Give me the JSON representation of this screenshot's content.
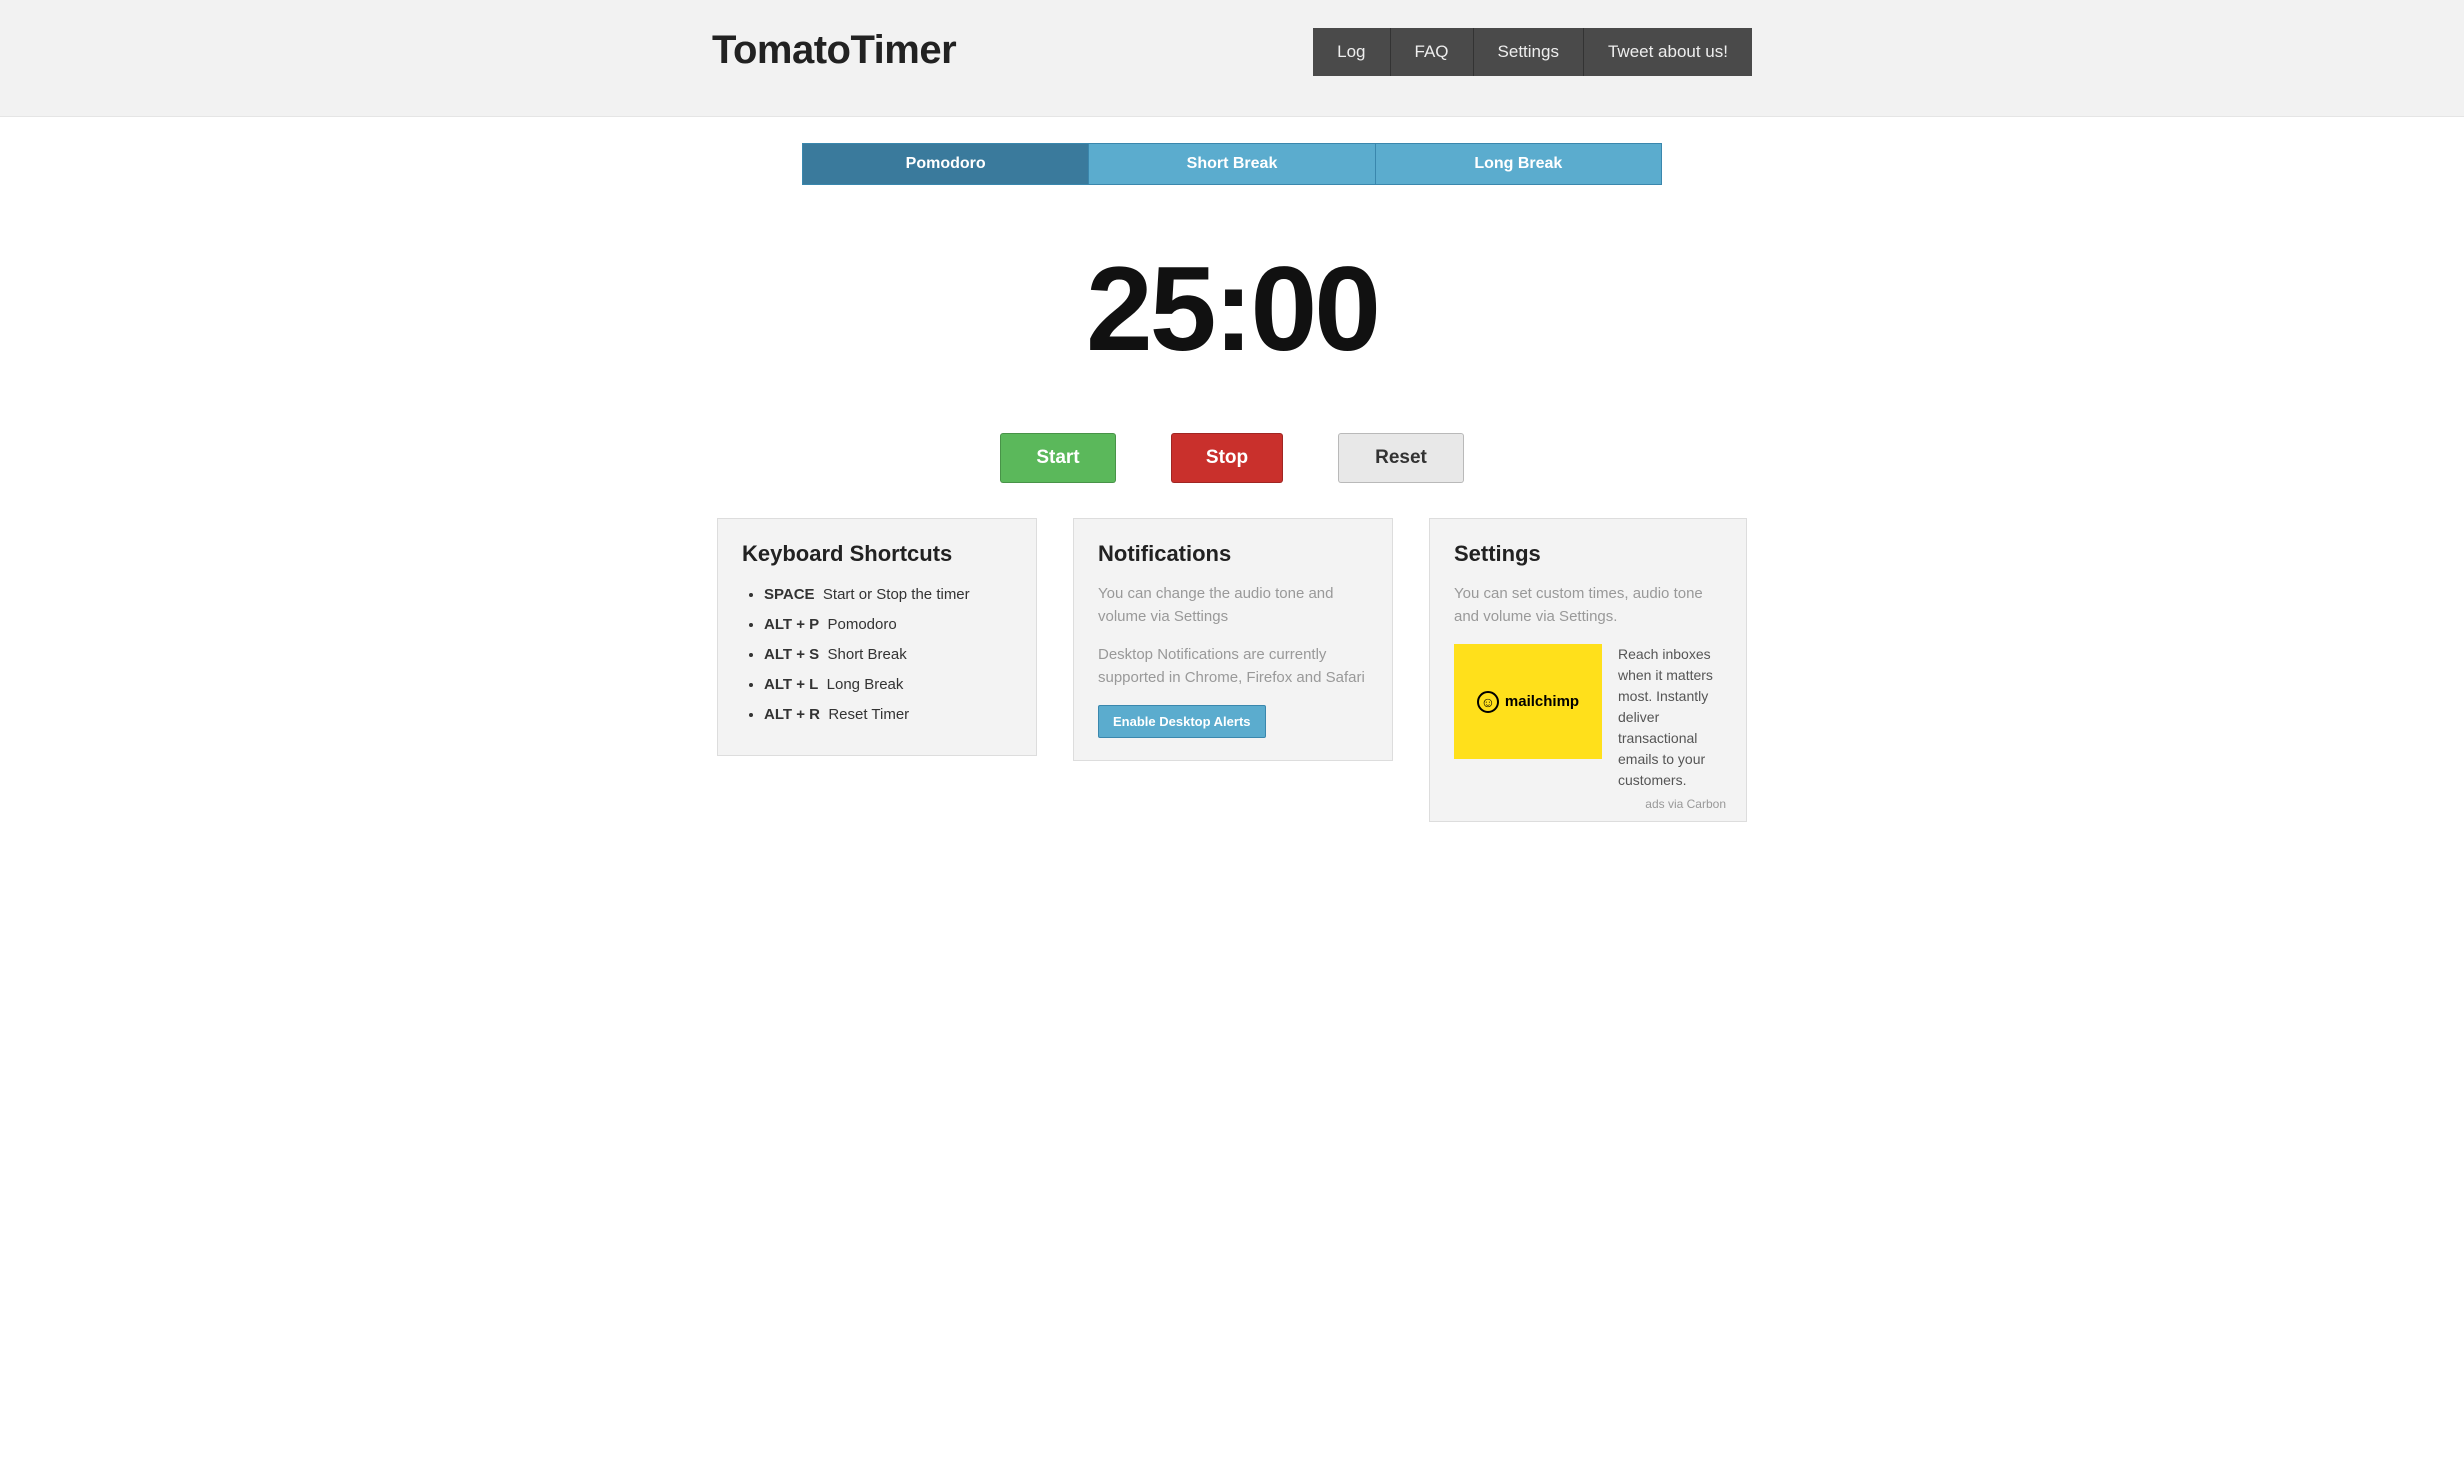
{
  "header": {
    "logo": "TomatoTimer",
    "nav": [
      "Log",
      "FAQ",
      "Settings",
      "Tweet about us!"
    ]
  },
  "tabs": [
    {
      "label": "Pomodoro",
      "active": true
    },
    {
      "label": "Short Break",
      "active": false
    },
    {
      "label": "Long Break",
      "active": false
    }
  ],
  "timer": {
    "display": "25:00"
  },
  "controls": {
    "start": "Start",
    "stop": "Stop",
    "reset": "Reset"
  },
  "shortcuts": {
    "title": "Keyboard Shortcuts",
    "items": [
      {
        "key": "SPACE",
        "desc": "Start or Stop the timer"
      },
      {
        "key": "ALT + P",
        "desc": "Pomodoro"
      },
      {
        "key": "ALT + S",
        "desc": "Short Break"
      },
      {
        "key": "ALT + L",
        "desc": "Long Break"
      },
      {
        "key": "ALT + R",
        "desc": "Reset Timer"
      }
    ]
  },
  "notifications": {
    "title": "Notifications",
    "p1": "You can change the audio tone and volume via Settings",
    "p2": "Desktop Notifications are currently supported in Chrome, Firefox and Safari",
    "button": "Enable Desktop Alerts"
  },
  "settings_panel": {
    "title": "Settings",
    "p1": "You can set custom times, audio tone and volume via Settings."
  },
  "ad": {
    "brand": "mailchimp",
    "copy": "Reach inboxes when it matters most. Instantly deliver transactional emails to your customers.",
    "attribution": "ads via Carbon"
  }
}
